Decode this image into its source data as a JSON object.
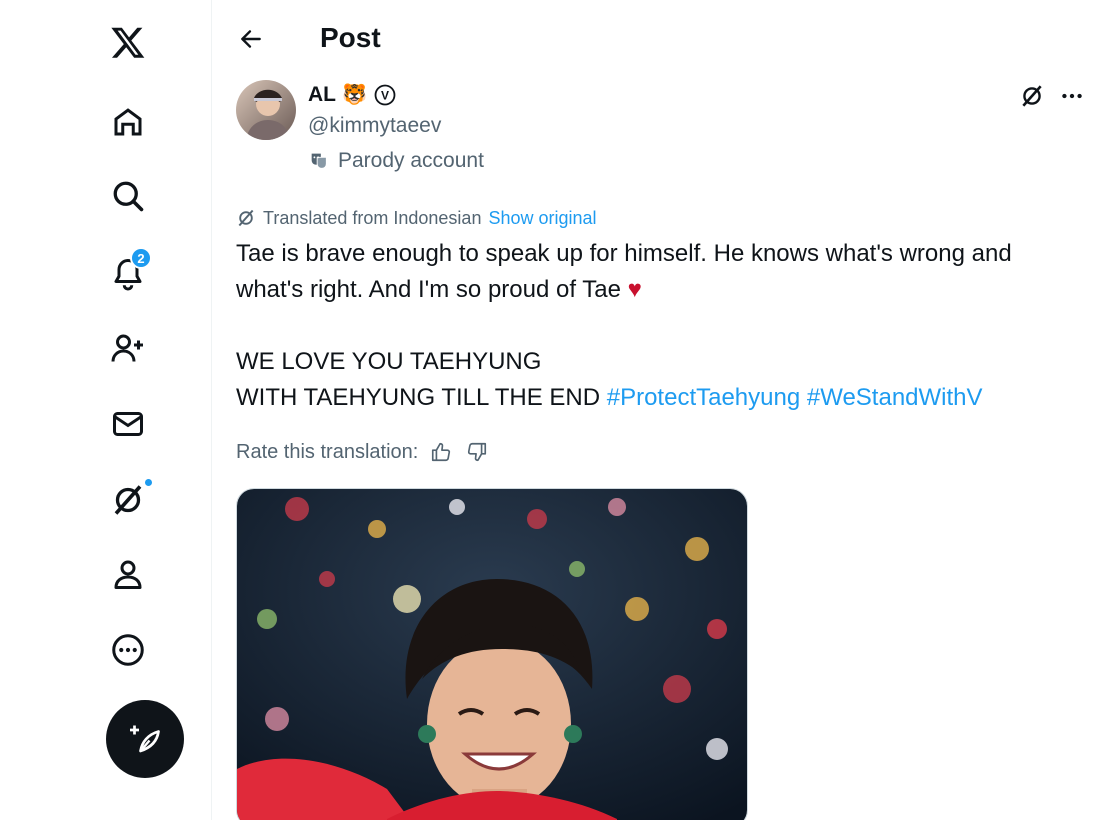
{
  "nav": {
    "logo_icon": "x-logo-icon",
    "items": [
      {
        "name": "home",
        "icon": "home-icon"
      },
      {
        "name": "explore",
        "icon": "search-icon"
      },
      {
        "name": "notifications",
        "icon": "bell-icon",
        "badge": "2"
      },
      {
        "name": "communities",
        "icon": "person-plus-icon"
      },
      {
        "name": "messages",
        "icon": "mail-icon"
      },
      {
        "name": "grok",
        "icon": "grok-icon"
      },
      {
        "name": "profile",
        "icon": "profile-icon"
      },
      {
        "name": "more",
        "icon": "more-circle-icon"
      }
    ],
    "compose_icon": "feather-plus-icon"
  },
  "header": {
    "title": "Post",
    "back_icon": "arrow-left-icon"
  },
  "author": {
    "display_name": "AL",
    "emoji": "🐯",
    "verified_label": "V",
    "handle": "@kimmytaeev",
    "parody_label": "Parody account"
  },
  "translation": {
    "notice": "Translated from Indonesian",
    "show_original": "Show original"
  },
  "post": {
    "line1": "Tae is brave enough to speak up for himself. He knows what's wrong and",
    "line2": "what's right. And I'm so proud of Tae",
    "heart": "♥",
    "line3": "WE LOVE YOU TAEHYUNG",
    "line4": "WITH TAEHYUNG TILL THE END",
    "hashtag1": "#ProtectTaehyung",
    "hashtag2": "#WeStandWithV"
  },
  "rating": {
    "label": "Rate this translation:"
  },
  "colors": {
    "accent": "#1d9bf0",
    "text": "#0f1419",
    "secondary": "#536471"
  }
}
